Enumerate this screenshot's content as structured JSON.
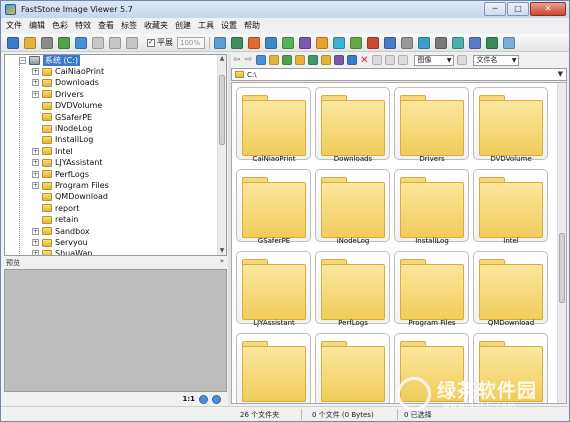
{
  "window": {
    "title": "FastStone Image Viewer 5.7",
    "controls": {
      "minimize": "─",
      "maximize": "□",
      "close": "✕"
    }
  },
  "menu": {
    "items": [
      "文件",
      "编辑",
      "色彩",
      "特效",
      "查看",
      "标签",
      "收藏夹",
      "创建",
      "工具",
      "设置",
      "帮助"
    ]
  },
  "toolbar": {
    "fit_label": "平展",
    "zoom_value": "100%",
    "icon_colors_left": [
      "#3b7bc8",
      "#e3b43a",
      "#8a8a8a",
      "#55a04a",
      "#4a90d9",
      "#c8c8c8",
      "#c8c8c8",
      "#c8c8c8"
    ],
    "icon_colors_right": [
      "#5aa0d8",
      "#3f8f5c",
      "#e06a30",
      "#3e88c8",
      "#58b058",
      "#7a5ab0",
      "#e8a030",
      "#3bb0d8",
      "#68a848",
      "#c84a3a",
      "#4a7ac8",
      "#999999",
      "#3aa0c8",
      "#7a7a7a",
      "#4ab0a8",
      "#5a7ac8",
      "#3a8a5a",
      "#7ab0d8"
    ]
  },
  "tree": {
    "root_label": "系统 (C:)",
    "items": [
      "CaiNiaoPrint",
      "Downloads",
      "Drivers",
      "DVDVolume",
      "GSaferPE",
      "iNodeLog",
      "InstallLog",
      "Intel",
      "LJYAssistant",
      "PerfLogs",
      "Program Files",
      "QMDownload",
      "report",
      "retain",
      "Sandbox",
      "Servyou",
      "ShuaWan"
    ],
    "expandable": [
      true,
      true,
      true,
      false,
      false,
      false,
      false,
      true,
      true,
      true,
      true,
      false,
      false,
      false,
      true,
      true,
      true
    ]
  },
  "preview": {
    "title": "预览",
    "pin": "»",
    "ratio": "1:1"
  },
  "right_toolbar": {
    "view_select": "图像",
    "sort_select": "文件名",
    "delete_glyph": "✕",
    "icon_colors": [
      "#4a90d9",
      "#e3b43a",
      "#55a04a",
      "#e3b43a",
      "#3a9a6a",
      "#e3b43a",
      "#7a5ab0",
      "#3b7bc8"
    ]
  },
  "address": {
    "path": "C:\\"
  },
  "thumbnails": {
    "items": [
      "CaiNiaoPrint",
      "Downloads",
      "Drivers",
      "DVDVolume",
      "GSaferPE",
      "iNodeLog",
      "InstallLog",
      "Intel",
      "LJYAssistant",
      "PerfLogs",
      "Program Files",
      "QMDownload",
      "",
      "",
      "",
      ""
    ]
  },
  "status": {
    "folders": "26 个文件夹",
    "files": "0 个文件 (0 Bytes)",
    "selected": "0 已选择"
  },
  "watermark": {
    "text": "绿茶软件园",
    "sub": "www.33LC.com"
  }
}
